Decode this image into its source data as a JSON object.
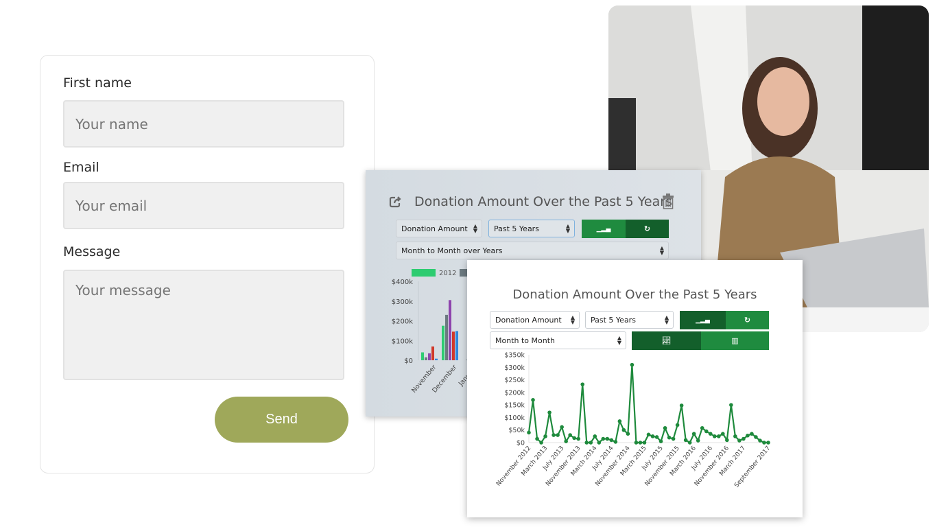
{
  "form": {
    "first_name_label": "First name",
    "first_name_placeholder": "Your name",
    "email_label": "Email",
    "email_placeholder": "Your email",
    "message_label": "Message",
    "message_placeholder": "Your message",
    "send_label": "Send",
    "send_color": "#9fa85a"
  },
  "back_panel": {
    "title": "Donation Amount Over the Past 5 Years",
    "metric_select": "Donation Amount",
    "period_select": "Past 5 Years",
    "view_select": "Month to Month over Years",
    "icons": [
      "share-icon",
      "trash-icon",
      "bar-signal-icon",
      "refresh-icon"
    ]
  },
  "front_panel": {
    "title": "Donation Amount Over the Past 5 Years",
    "metric_select": "Donation Amount",
    "period_select": "Past 5 Years",
    "view_select": "Month to Month",
    "icons": [
      "bar-signal-icon",
      "refresh-icon",
      "line-chart-icon",
      "bar-chart-icon"
    ]
  },
  "chart_data": [
    {
      "type": "bar",
      "categories": [
        "November",
        "December",
        "January"
      ],
      "series": [
        {
          "name": "2012",
          "color": "#2ecc71",
          "values": [
            40,
            175,
            null
          ]
        },
        {
          "color": "#6c7a80",
          "values": [
            15,
            230,
            2
          ]
        },
        {
          "color": "#8e44ad",
          "values": [
            35,
            305,
            null
          ]
        },
        {
          "color": "#d0392b",
          "values": [
            70,
            145,
            null
          ]
        },
        {
          "color": "#2e86de",
          "values": [
            8,
            148,
            null
          ]
        }
      ],
      "yticks": [
        "$0",
        "$100k",
        "$200k",
        "$300k",
        "$400k"
      ],
      "ylim": [
        0,
        400
      ],
      "unit": "thousand USD",
      "legend": "top"
    },
    {
      "type": "line",
      "color": "#1e8a3c",
      "x_start": "November 2012",
      "x_end": "September 2017",
      "interval": "monthly",
      "xticks": [
        "November 2012",
        "March 2013",
        "July 2013",
        "November 2013",
        "March 2014",
        "July 2014",
        "November 2014",
        "March 2015",
        "July 2015",
        "November 2015",
        "March 2016",
        "July 2016",
        "November 2016",
        "March 2017",
        "September 2017"
      ],
      "yticks": [
        "$0",
        "$50k",
        "$100k",
        "$150k",
        "$200k",
        "$250k",
        "$300k",
        "$350k"
      ],
      "ylim": [
        0,
        350
      ],
      "unit": "thousand USD",
      "values": [
        40,
        170,
        15,
        0,
        25,
        120,
        30,
        30,
        62,
        5,
        30,
        18,
        15,
        232,
        0,
        0,
        25,
        0,
        15,
        15,
        10,
        3,
        85,
        50,
        35,
        310,
        0,
        0,
        0,
        32,
        25,
        22,
        5,
        58,
        20,
        15,
        70,
        148,
        10,
        0,
        35,
        8,
        58,
        45,
        35,
        25,
        25,
        35,
        10,
        150,
        25,
        8,
        15,
        28,
        35,
        22,
        8,
        0,
        0
      ]
    }
  ]
}
